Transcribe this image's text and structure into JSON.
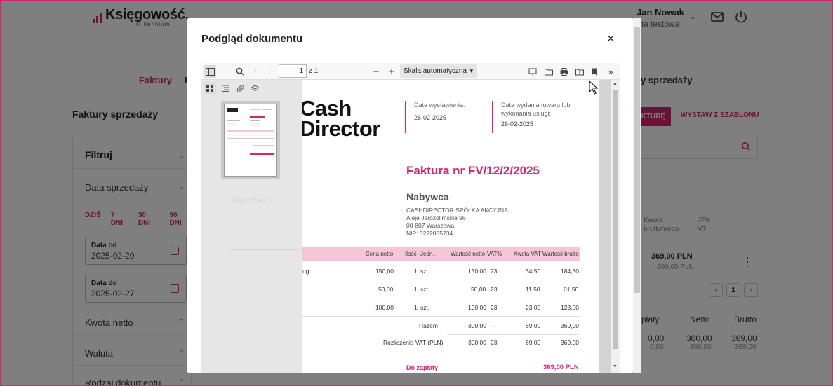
{
  "app": {
    "logo_text": "Księgowość",
    "logo_dot": ".",
    "logo_sub": "Millennium",
    "user_name": "Jan Nowak",
    "user_company": "ma testowa",
    "nav_invoices": "Faktury",
    "nav_second": "F",
    "nav_right": "ny sprzedaży",
    "page_title": "Faktury sprzedaży",
    "btn_add_invoice": "KTURĘ",
    "btn_template": "WYSTAW Z SZABLONU",
    "filter": {
      "title": "Filtruj",
      "sale_date": "Data sprzedaży",
      "quick": [
        "DZIŚ",
        "7 DNI",
        "30 DNI",
        "90 DNI"
      ],
      "date_from_label": "Data od",
      "date_from_value": "2025-02-20",
      "date_to_label": "Data do",
      "date_to_value": "2025-02-27",
      "net_amount": "Kwota netto",
      "currency": "Waluta",
      "doc_type": "Rodzaj dokumentu"
    },
    "list": {
      "col_amount_1": "Kwota",
      "col_amount_2": "brutto/netto",
      "col_jpk_1": "JPK",
      "col_jpk_2": "V7",
      "gross": "369,00 PLN",
      "net": "300,00 PLN",
      "page_current": "1",
      "prev": "‹",
      "next": "›"
    },
    "summary": {
      "headers": [
        "płaty",
        "Netto",
        "Brutto"
      ],
      "values": [
        "0,00",
        "300,00",
        "369,00"
      ],
      "sub_values": [
        "0,00",
        "300,00",
        "369,00"
      ]
    }
  },
  "modal": {
    "title": "Podgląd dokumentu",
    "close": "×",
    "viewer": {
      "page_value": "1",
      "page_of": "z 1",
      "zoom": "Skala automatyczna",
      "zoom_arrow": "▾"
    },
    "invoice": {
      "logo_line1": "Cash",
      "logo_line2": "Director",
      "issue_date_label": "Data wystawienia:",
      "issue_date": "26-02-2025",
      "delivery_label_1": "Data wydania towaru lub",
      "delivery_label_2": "wykonania usługi:",
      "delivery_date": "26-02-2025",
      "title": "Faktura nr FV/12/2/2025",
      "buyer_header": "Nabywca",
      "buyer_lines": [
        "CASHDIRECTOR SPÓŁKA AKCYJNA",
        "Aleje Jerozolimskie 96",
        "00-807 Warszawa",
        "NIP: 5222885734"
      ],
      "seller_header": "Wystawca",
      "table_headers": [
        "Cena netto",
        "Ilość",
        "Jedn.",
        "Wartość netto",
        "VAT%",
        "Kwota VAT",
        "Wartość brutto"
      ],
      "rows": [
        {
          "name": "ug",
          "price": "150,00",
          "qty": "1",
          "unit": "szt.",
          "net": "150,00",
          "vat": "23",
          "vat_amt": "34,50",
          "gross": "184,50"
        },
        {
          "name": "",
          "price": "50,00",
          "qty": "1",
          "unit": "szt.",
          "net": "50,00",
          "vat": "23",
          "vat_amt": "11,50",
          "gross": "61,50"
        },
        {
          "name": "",
          "price": "100,00",
          "qty": "1",
          "unit": "szt.",
          "net": "100,00",
          "vat": "23",
          "vat_amt": "23,00",
          "gross": "123,00"
        }
      ],
      "total_label": "Razem",
      "total_net": "300,00",
      "total_vat": "---",
      "total_vat_amt": "69,00",
      "total_gross": "369,00",
      "vat_settle_label": "Rozliczenie VAT (PLN)",
      "vat_settle_net": "300,00",
      "vat_settle_rate": "23",
      "vat_settle_amt": "69,00",
      "vat_settle_gross": "369,00",
      "due_label": "Do zapłaty",
      "due_value": "369,00 PLN"
    }
  },
  "colors": {
    "accent": "#d6246e",
    "highlight": "#f5c6d8"
  }
}
